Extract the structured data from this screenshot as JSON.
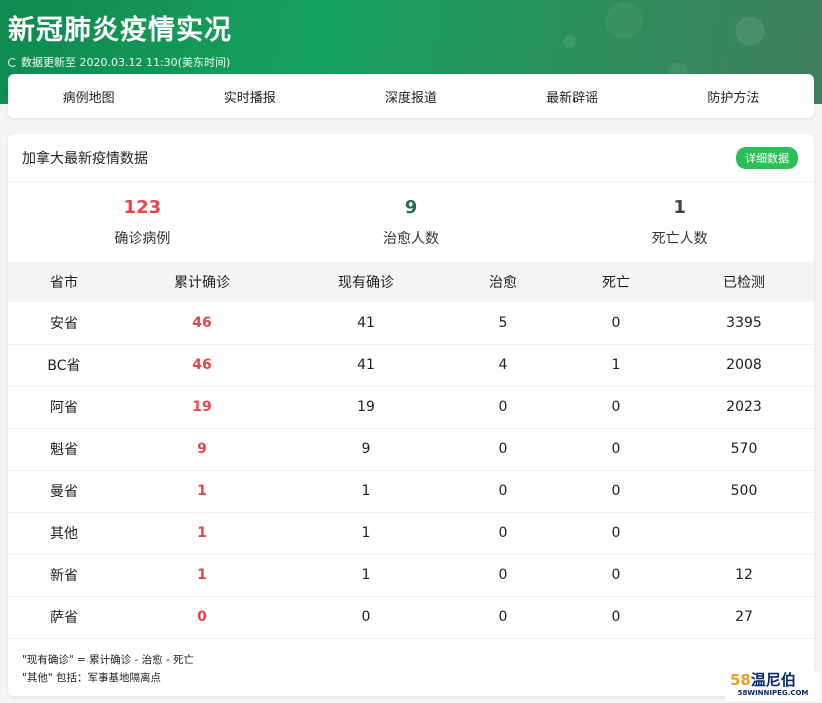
{
  "header": {
    "title": "新冠肺炎疫情实况",
    "updated": "数据更新至 2020.03.12 11:30(美东时间)"
  },
  "nav": [
    "病例地图",
    "实时播报",
    "深度报道",
    "最新辟谣",
    "防护方法"
  ],
  "card": {
    "title": "加拿大最新疫情数据",
    "detail_button": "详细数据"
  },
  "summary": [
    {
      "value": "123",
      "label": "确诊病例"
    },
    {
      "value": "9",
      "label": "治愈人数"
    },
    {
      "value": "1",
      "label": "死亡人数"
    }
  ],
  "table": {
    "headers": [
      "省市",
      "累计确诊",
      "现有确诊",
      "治愈",
      "死亡",
      "已检测"
    ],
    "rows": [
      [
        "安省",
        "46",
        "41",
        "5",
        "0",
        "3395"
      ],
      [
        "BC省",
        "46",
        "41",
        "4",
        "1",
        "2008"
      ],
      [
        "阿省",
        "19",
        "19",
        "0",
        "0",
        "2023"
      ],
      [
        "魁省",
        "9",
        "9",
        "0",
        "0",
        "570"
      ],
      [
        "曼省",
        "1",
        "1",
        "0",
        "0",
        "500"
      ],
      [
        "其他",
        "1",
        "1",
        "0",
        "0",
        ""
      ],
      [
        "新省",
        "1",
        "1",
        "0",
        "0",
        "12"
      ],
      [
        "萨省",
        "0",
        "0",
        "0",
        "0",
        "27"
      ]
    ]
  },
  "notes": [
    "\"现有确诊\" = 累计确诊 - 治愈 - 死亡",
    "\"其他\" 包括：军事基地隔离点"
  ],
  "watermark": {
    "top_number": "58",
    "top_text": "温尼伯",
    "bottom": "58WINNIPEG.COM"
  },
  "colors": {
    "confirmed": "#e8454a",
    "cured": "#25704a",
    "death": "#444444",
    "accent": "#2bbf5a"
  }
}
